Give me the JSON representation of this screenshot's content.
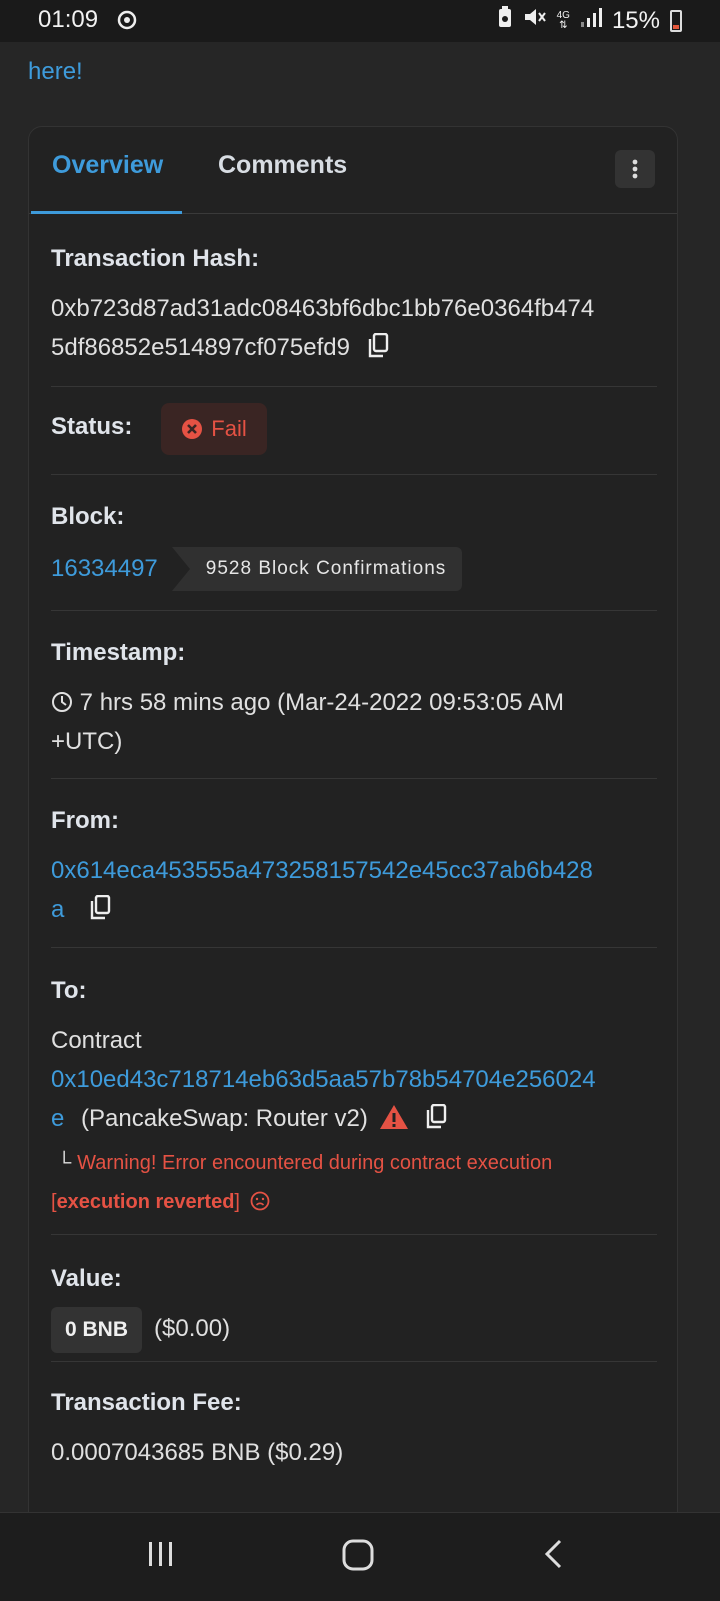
{
  "status_bar": {
    "time": "01:09",
    "battery_percent": "15%",
    "network": "4G"
  },
  "page": {
    "top_link": "here!"
  },
  "tabs": [
    {
      "label": "Overview",
      "active": true
    },
    {
      "label": "Comments",
      "active": false
    }
  ],
  "tx": {
    "hash_label": "Transaction Hash:",
    "hash_line1": "0xb723d87ad31adc08463bf6dbc1bb76e0364fb474",
    "hash_line2": "5df86852e514897cf075efd9",
    "status_label": "Status:",
    "status_value": "Fail",
    "block_label": "Block:",
    "block_number": "16334497",
    "block_confirmations": "9528 Block Confirmations",
    "timestamp_label": "Timestamp:",
    "timestamp_line1": "7 hrs 58 mins ago (Mar-24-2022 09:53:05 AM",
    "timestamp_line2": "+UTC)",
    "from_label": "From:",
    "from_line1": "0x614eca453555a473258157542e45cc37ab6b428",
    "from_line2": "a",
    "to_label": "To:",
    "to_contract_word": "Contract",
    "to_line1": "0x10ed43c718714eb63d5aa57b78b54704e256024",
    "to_line2": "e",
    "to_name": "(PancakeSwap: Router v2)",
    "warning_text": "Warning! Error encountered during contract execution",
    "warning_reason": "execution reverted",
    "value_label": "Value:",
    "value_badge": "0 BNB",
    "value_usd": "($0.00)",
    "fee_label": "Transaction Fee:",
    "fee_value": "0.0007043685 BNB ($0.29)"
  },
  "colors": {
    "link": "#3e9bdb",
    "fail": "#e55244",
    "background": "#262626",
    "card": "#222222"
  }
}
